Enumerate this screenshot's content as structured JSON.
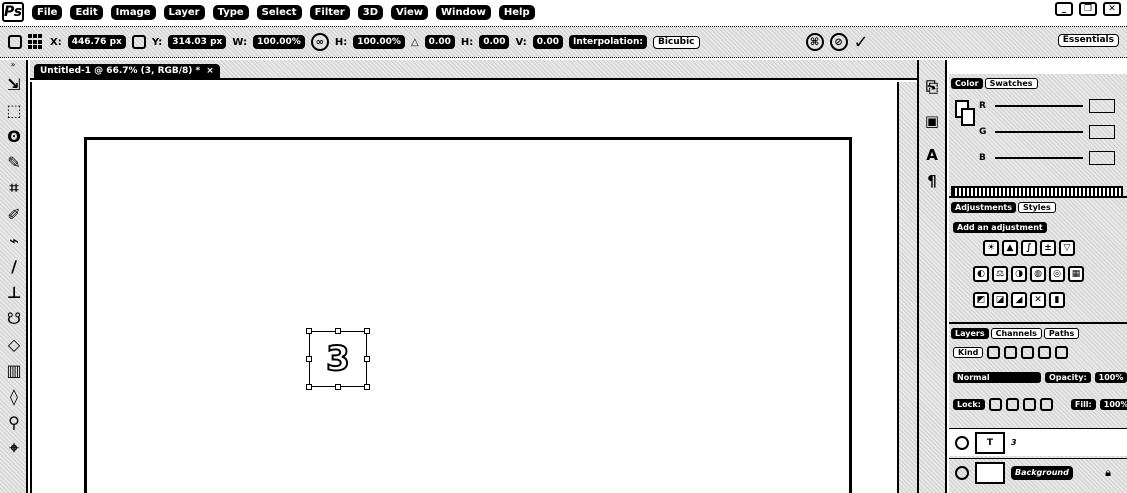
{
  "app": {
    "logo_text": "Ps"
  },
  "menu": [
    "File",
    "Edit",
    "Image",
    "Layer",
    "Type",
    "Select",
    "Filter",
    "3D",
    "View",
    "Window",
    "Help"
  ],
  "window_controls": {
    "minimize": "_",
    "restore": "❐",
    "close": "✕"
  },
  "options_bar": {
    "x_label": "X:",
    "x_value": "446.76 px",
    "y_label": "Y:",
    "y_value": "314.03 px",
    "w_label": "W:",
    "w_value": "100.00%",
    "h_label": "H:",
    "h_value": "100.00%",
    "angle_value": "0.00",
    "h_skew_label": "H:",
    "h_skew_value": "0.00",
    "v_skew_label": "V:",
    "v_skew_value": "0.00",
    "interpolation_label": "Interpolation:",
    "interpolation_value": "Bicubic",
    "workspace_value": "Essentials"
  },
  "document": {
    "tab_title": "Untitled-1 @ 66.7% (3, RGB/8) *",
    "close_glyph": "×",
    "text_layer_content": "3"
  },
  "panels": {
    "color_tabs": [
      "Color",
      "Swatches"
    ],
    "rgb_letters": [
      "R",
      "G",
      "B"
    ],
    "adjust_tabs": [
      "Adjustments",
      "Styles"
    ],
    "adjust_add_label": "Add an adjustment",
    "layers_tabs": [
      "Layers",
      "Channels",
      "Paths"
    ],
    "layer_kind": "Kind",
    "blend_mode": "Normal",
    "opacity_label": "Opacity:",
    "opacity_value": "100%",
    "lock_label": "Lock:",
    "fill_label": "Fill:",
    "fill_value": "100%",
    "layers": [
      {
        "name": "3",
        "thumb": "T"
      },
      {
        "name": "Background",
        "thumb": ""
      }
    ]
  }
}
